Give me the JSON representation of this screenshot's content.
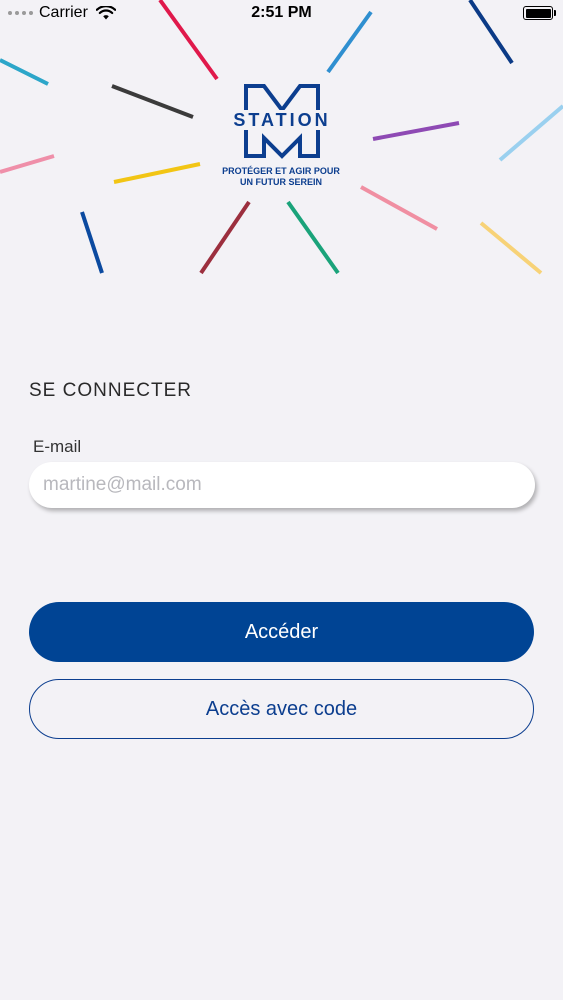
{
  "status_bar": {
    "carrier": "Carrier",
    "time": "2:51 PM"
  },
  "brand": {
    "wordmark": "STATION",
    "tagline_line1": "PROTÉGER ET AGIR POUR",
    "tagline_line2": "UN FUTUR SEREIN",
    "color": "#0c3e8f"
  },
  "login": {
    "title": "SE CONNECTER",
    "email_label": "E-mail",
    "email_placeholder": "martine@mail.com",
    "email_value": ""
  },
  "actions": {
    "primary_label": "Accéder",
    "secondary_label": "Accès avec code"
  },
  "colors": {
    "primary": "#004494",
    "background": "#f3f2f6"
  }
}
